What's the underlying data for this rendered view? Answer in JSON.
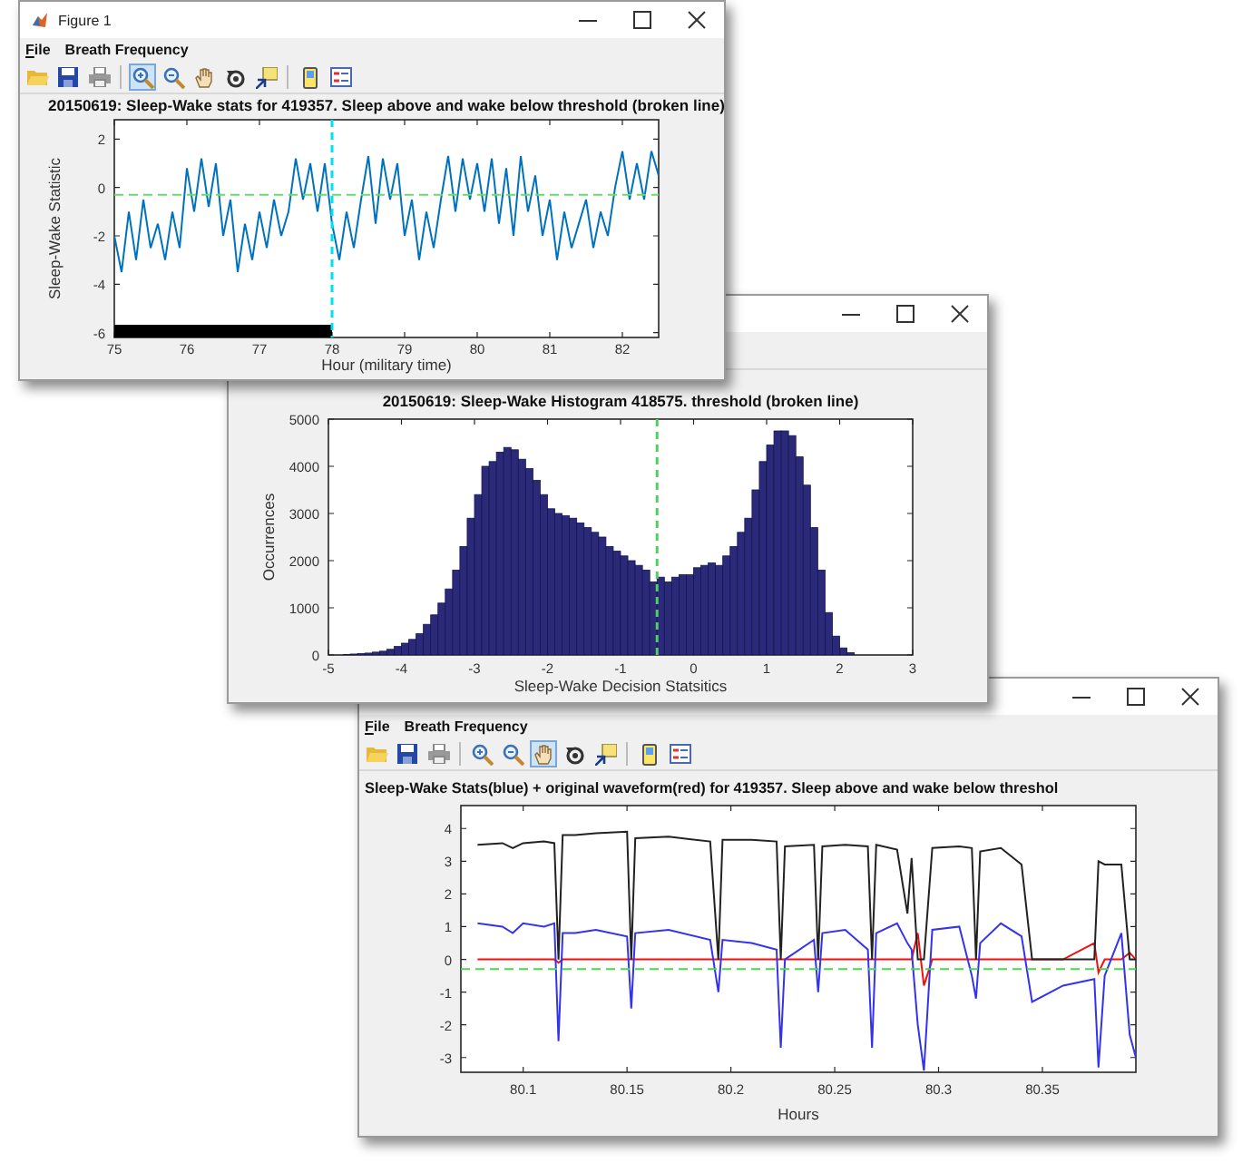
{
  "windows": [
    {
      "title": "Figure 1",
      "menu": [
        "File",
        "Breath Frequency"
      ],
      "toolbar": [
        {
          "kind": "open",
          "selected": false
        },
        {
          "kind": "save",
          "selected": false
        },
        {
          "kind": "print",
          "selected": false
        },
        {
          "kind": "zoom-in",
          "selected": true
        },
        {
          "kind": "zoom-out",
          "selected": false
        },
        {
          "kind": "pan",
          "selected": false
        },
        {
          "kind": "rotate",
          "selected": false
        },
        {
          "kind": "cursor",
          "selected": false
        },
        {
          "kind": "colorbar",
          "selected": false
        },
        {
          "kind": "legend",
          "selected": false
        }
      ],
      "chart_data": {
        "type": "line",
        "title": "20150619: Sleep-Wake stats for 419357. Sleep above and wake below threshold (broken line)",
        "xlabel": "Hour (military time)",
        "ylabel": "Sleep-Wake Statistic",
        "x": [
          75,
          75.1,
          75.2,
          75.3,
          75.4,
          75.5,
          75.6,
          75.7,
          75.8,
          75.9,
          76,
          76.1,
          76.2,
          76.3,
          76.4,
          76.5,
          76.6,
          76.7,
          76.8,
          76.9,
          77,
          77.1,
          77.2,
          77.3,
          77.4,
          77.5,
          77.6,
          77.7,
          77.8,
          77.9,
          78,
          78.1,
          78.2,
          78.3,
          78.4,
          78.5,
          78.6,
          78.7,
          78.8,
          78.9,
          79,
          79.1,
          79.2,
          79.3,
          79.4,
          79.5,
          79.6,
          79.7,
          79.8,
          79.9,
          80,
          80.1,
          80.2,
          80.3,
          80.4,
          80.5,
          80.6,
          80.7,
          80.8,
          80.9,
          81,
          81.1,
          81.2,
          81.3,
          81.4,
          81.5,
          81.6,
          81.7,
          81.8,
          81.9,
          82,
          82.1,
          82.2,
          82.3,
          82.4,
          82.5
        ],
        "series": [
          {
            "color": "#0072bd",
            "values": [
              -2,
              -3.5,
              -1,
              -3,
              -0.5,
              -2.5,
              -1.5,
              -3,
              -1,
              -2.5,
              0.8,
              -1,
              1.2,
              -0.8,
              1,
              -2,
              -0.5,
              -3.5,
              -1.5,
              -3,
              -1,
              -2.5,
              -0.5,
              -2,
              -1,
              1.2,
              -0.5,
              1,
              -1,
              1,
              -1.5,
              -3,
              -1,
              -2.5,
              -0.5,
              1.3,
              -1.5,
              1.2,
              -0.5,
              1,
              -2,
              -0.5,
              -3,
              -1,
              -2.5,
              -0.5,
              1.3,
              -1,
              1.2,
              -0.5,
              1,
              -1,
              1.2,
              -1.5,
              0.8,
              -2,
              1.3,
              -1,
              0.5,
              -2,
              -0.5,
              -3,
              -1,
              -2.5,
              -1.5,
              -0.5,
              -2.5,
              -1,
              -2,
              0,
              1.5,
              -0.5,
              1,
              -0.5,
              1.5,
              0.5
            ]
          }
        ],
        "xlim": [
          75,
          82.5
        ],
        "ylim": [
          -6.2,
          2.8
        ],
        "xticks": [
          75,
          76,
          77,
          78,
          79,
          80,
          81,
          82
        ],
        "yticks": [
          -6,
          -4,
          -2,
          0,
          2
        ],
        "bands": [
          {
            "axis": "x",
            "from": 75,
            "to": 78,
            "color": "#000000"
          }
        ],
        "ref_lines": [
          {
            "axis": "y",
            "value": -0.3,
            "color": "#66dd66"
          },
          {
            "axis": "x",
            "value": 78,
            "color": "#00e0f0"
          }
        ]
      }
    },
    {
      "chart_data": {
        "type": "bar",
        "title": "20150619: Sleep-Wake Histogram 418575. threshold (broken line)",
        "xlabel": "Sleep-Wake Decision Statsitics",
        "ylabel": "Occurrences",
        "x": [
          -4.75,
          -4.65,
          -4.55,
          -4.45,
          -4.35,
          -4.25,
          -4.15,
          -4.05,
          -3.95,
          -3.85,
          -3.75,
          -3.65,
          -3.55,
          -3.45,
          -3.35,
          -3.25,
          -3.15,
          -3.05,
          -2.95,
          -2.85,
          -2.75,
          -2.65,
          -2.55,
          -2.45,
          -2.35,
          -2.25,
          -2.15,
          -2.05,
          -1.95,
          -1.85,
          -1.75,
          -1.65,
          -1.55,
          -1.45,
          -1.35,
          -1.25,
          -1.15,
          -1.05,
          -0.95,
          -0.85,
          -0.75,
          -0.65,
          -0.55,
          -0.45,
          -0.35,
          -0.25,
          -0.15,
          -0.05,
          0.05,
          0.15,
          0.25,
          0.35,
          0.45,
          0.55,
          0.65,
          0.75,
          0.85,
          0.95,
          1.05,
          1.15,
          1.25,
          1.35,
          1.45,
          1.55,
          1.65,
          1.75,
          1.85,
          1.95,
          2.05,
          2.15
        ],
        "series": [
          {
            "color": "#2b2a7a",
            "values": [
              10,
              20,
              30,
              40,
              60,
              80,
              120,
              180,
              250,
              330,
              450,
              650,
              850,
              1100,
              1400,
              1800,
              2300,
              2900,
              3400,
              4000,
              4100,
              4300,
              4400,
              4350,
              4150,
              3950,
              3700,
              3400,
              3100,
              3000,
              2950,
              2900,
              2800,
              2700,
              2600,
              2500,
              2300,
              2200,
              2100,
              2000,
              1900,
              1800,
              1550,
              1650,
              1550,
              1650,
              1700,
              1700,
              1850,
              1900,
              1950,
              1900,
              2100,
              2300,
              2600,
              2900,
              3500,
              4100,
              4450,
              4750,
              4750,
              4650,
              4200,
              3600,
              2700,
              1800,
              900,
              400,
              150,
              50
            ]
          }
        ],
        "xlim": [
          -5,
          3
        ],
        "ylim": [
          0,
          5000
        ],
        "xticks": [
          -5,
          -4,
          -3,
          -2,
          -1,
          0,
          1,
          2,
          3
        ],
        "yticks": [
          0,
          1000,
          2000,
          3000,
          4000,
          5000
        ],
        "ref_lines": [
          {
            "axis": "x",
            "value": -0.5,
            "color": "#55cc66"
          }
        ]
      }
    },
    {
      "menu": [
        "File",
        "Breath Frequency"
      ],
      "toolbar": [
        {
          "kind": "open",
          "selected": false
        },
        {
          "kind": "save",
          "selected": false
        },
        {
          "kind": "print",
          "selected": false
        },
        {
          "kind": "zoom-in",
          "selected": false
        },
        {
          "kind": "zoom-out",
          "selected": false
        },
        {
          "kind": "pan",
          "selected": true
        },
        {
          "kind": "rotate",
          "selected": false
        },
        {
          "kind": "cursor",
          "selected": false
        },
        {
          "kind": "colorbar",
          "selected": false
        },
        {
          "kind": "legend",
          "selected": false
        }
      ],
      "chart_data": {
        "type": "line",
        "title": "Sleep-Wake Stats(blue) + original waveform(red) for 419357. Sleep above and wake below threshol",
        "xlabel": "Hours",
        "x": [
          80.078,
          80.09,
          80.095,
          80.1,
          80.11,
          80.115,
          80.117,
          80.119,
          80.125,
          80.135,
          80.15,
          80.152,
          80.154,
          80.17,
          80.19,
          80.194,
          80.196,
          80.21,
          80.222,
          80.224,
          80.226,
          80.24,
          80.242,
          80.244,
          80.255,
          80.266,
          80.268,
          80.27,
          80.28,
          80.285,
          80.287,
          80.29,
          80.293,
          80.297,
          80.31,
          80.316,
          80.318,
          80.32,
          80.33,
          80.34,
          80.345,
          80.36,
          80.375,
          80.377,
          80.38,
          80.388,
          80.392,
          80.395
        ],
        "series": [
          {
            "color": "#ee1111",
            "values": [
              0,
              0,
              0,
              0,
              0,
              0,
              -0.1,
              0,
              0,
              0,
              0,
              0,
              0,
              0,
              0,
              0,
              0,
              0,
              0,
              0,
              0,
              0,
              0,
              0,
              0,
              0,
              0,
              0,
              0,
              0,
              0,
              0.8,
              -0.8,
              0,
              0,
              0,
              0,
              0,
              0,
              0,
              0,
              0,
              0.5,
              -0.4,
              0,
              0,
              0.2,
              0
            ]
          },
          {
            "color": "#222222",
            "values": [
              3.5,
              3.55,
              3.4,
              3.55,
              3.6,
              3.55,
              0,
              3.8,
              3.8,
              3.85,
              3.9,
              0,
              3.7,
              3.75,
              3.6,
              0,
              3.65,
              3.65,
              3.6,
              0,
              3.45,
              3.5,
              0,
              3.45,
              3.5,
              3.45,
              0,
              3.5,
              3.35,
              1.4,
              3.1,
              0,
              0,
              3.4,
              3.45,
              3.4,
              0,
              3.3,
              3.4,
              2.9,
              0,
              0,
              0,
              3,
              2.9,
              2.9,
              0,
              0
            ]
          },
          {
            "color": "#3333ee",
            "values": [
              1.1,
              1,
              0.8,
              1.1,
              1,
              1.1,
              -2.5,
              0.8,
              0.8,
              0.9,
              0.7,
              -1.5,
              0.8,
              0.9,
              0.6,
              -1,
              0.6,
              0.5,
              0.3,
              -2.7,
              0,
              0.6,
              -1,
              0.8,
              0.9,
              0.3,
              -2.7,
              0.8,
              1.1,
              0.5,
              0.3,
              -2,
              -3.4,
              0.9,
              1,
              -0.5,
              -1.2,
              0.5,
              1.1,
              0.7,
              -1.3,
              -0.8,
              -0.6,
              -3.3,
              -0.5,
              0.8,
              -2.3,
              -3
            ]
          }
        ],
        "xlim": [
          80.07,
          80.395
        ],
        "ylim": [
          -3.45,
          4.7
        ],
        "xticks": [
          80.1,
          80.15,
          80.2,
          80.25,
          80.3,
          80.35
        ],
        "yticks": [
          -3,
          -2,
          -1,
          0,
          1,
          2,
          3,
          4
        ],
        "ref_lines": [
          {
            "axis": "y",
            "value": -0.3,
            "color": "#44dd44"
          }
        ]
      }
    }
  ]
}
